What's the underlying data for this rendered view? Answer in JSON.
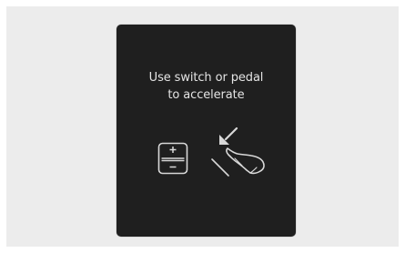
{
  "message": {
    "line1": "Use switch or pedal",
    "line2": "to accelerate"
  },
  "icons": {
    "switch": "plus-minus-switch-icon",
    "pedal": "foot-pedal-icon",
    "arrow": "press-arrow-icon"
  },
  "colors": {
    "backdrop": "#ececec",
    "panel": "#1f1f1f",
    "text": "#e4e4e4",
    "icon_stroke": "#d8d8d8"
  }
}
